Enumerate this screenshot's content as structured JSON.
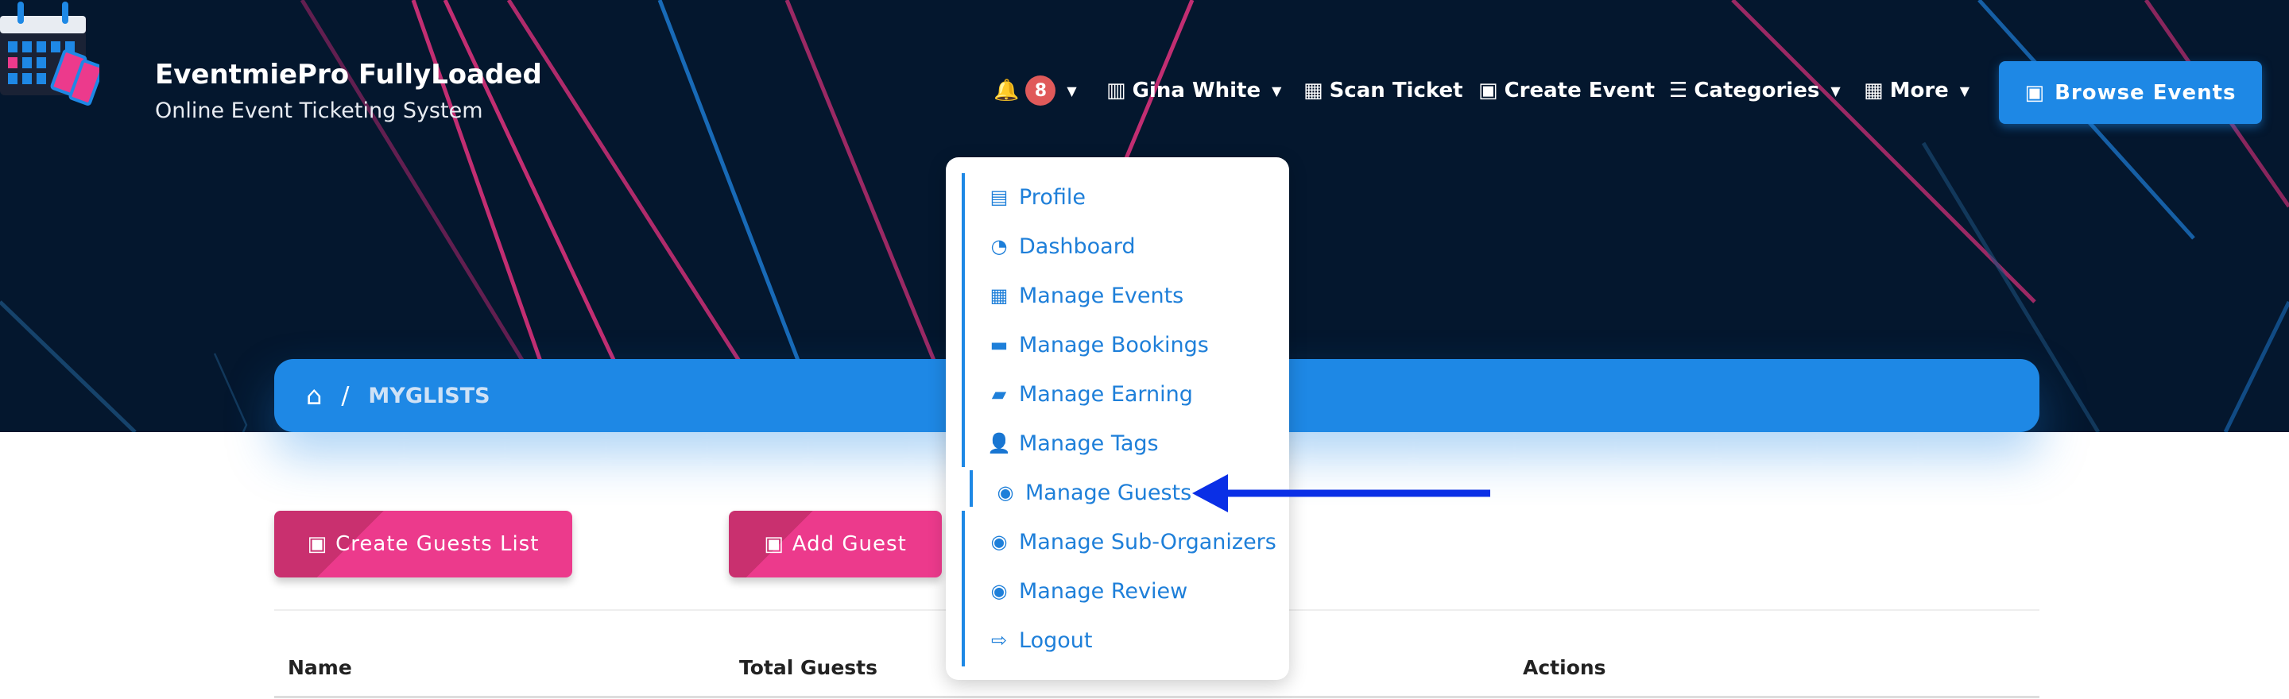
{
  "brand": {
    "title": "EventmiePro FullyLoaded",
    "subtitle": "Online Event Ticketing System"
  },
  "nav": {
    "notifications_count": "8",
    "user": "Gina White",
    "scan_ticket": "Scan Ticket",
    "create_event": "Create Event",
    "categories": "Categories",
    "more": "More",
    "browse_events": "Browse Events"
  },
  "page": {
    "title": "MYGLISTS",
    "breadcrumb_current": "MYGLISTS",
    "breadcrumb_sep": "/"
  },
  "actions": {
    "create_guests_list": "Create Guests List",
    "add_guest": "Add Guest"
  },
  "table": {
    "headers": [
      "Name",
      "Total Guests",
      "Actions"
    ]
  },
  "dropdown": {
    "items": [
      {
        "label": "Profile",
        "icon": "id-card-icon"
      },
      {
        "label": "Dashboard",
        "icon": "gauge-icon"
      },
      {
        "label": "Manage Events",
        "icon": "calendar-icon"
      },
      {
        "label": "Manage Bookings",
        "icon": "money-check-icon"
      },
      {
        "label": "Manage Earning",
        "icon": "wallet-icon"
      },
      {
        "label": "Manage Tags",
        "icon": "user-tag-icon"
      },
      {
        "label": "Manage Guests",
        "icon": "user-circle-icon"
      },
      {
        "label": "Manage Sub-Organizers",
        "icon": "user-circle-icon"
      },
      {
        "label": "Manage Review",
        "icon": "user-circle-icon"
      },
      {
        "label": "Logout",
        "icon": "sign-out-icon"
      }
    ]
  },
  "colors": {
    "header_bg": "#04172e",
    "accent": "#1e88e5",
    "pink": "#ec3a8c",
    "arrow": "#0a2fe6",
    "badge": "#e05a5a"
  }
}
